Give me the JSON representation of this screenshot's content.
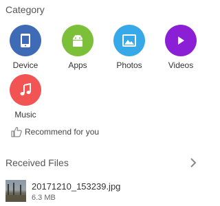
{
  "category": {
    "title": "Category",
    "items": [
      {
        "label": "Device",
        "icon": "phone-icon",
        "color": "#3f6ab5"
      },
      {
        "label": "Apps",
        "icon": "android-icon",
        "color": "#7cc03a"
      },
      {
        "label": "Photos",
        "icon": "image-icon",
        "color": "#38a9e8"
      },
      {
        "label": "Videos",
        "icon": "play-icon",
        "color": "#8b1fd6"
      },
      {
        "label": "Music",
        "icon": "music-note-icon",
        "color": "#f25353"
      }
    ]
  },
  "recommend": {
    "label": "Recommend for you",
    "icon": "thumbs-up-icon"
  },
  "received": {
    "title": "Received Files",
    "files": [
      {
        "name": "20171210_153239.jpg",
        "size": "6.3 MB"
      }
    ]
  }
}
